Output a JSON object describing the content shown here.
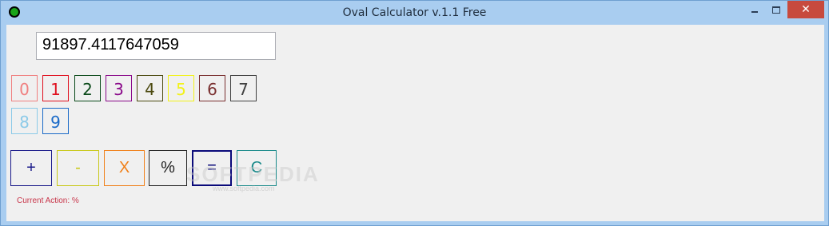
{
  "window": {
    "title": "Oval Calculator v.1.1  Free",
    "controls": {
      "minimize": "",
      "maximize": "",
      "close": "✕"
    }
  },
  "display": {
    "value": "91897.4117647059"
  },
  "digits": [
    {
      "label": "0",
      "color": "#f08080"
    },
    {
      "label": "1",
      "color": "#e0101f"
    },
    {
      "label": "2",
      "color": "#0b4a1a"
    },
    {
      "label": "3",
      "color": "#8a0a8a"
    },
    {
      "label": "4",
      "color": "#4c4a10"
    },
    {
      "label": "5",
      "color": "#f2f21a"
    },
    {
      "label": "6",
      "color": "#7a3030"
    },
    {
      "label": "7",
      "color": "#404040"
    },
    {
      "label": "8",
      "color": "#8ccae8"
    },
    {
      "label": "9",
      "color": "#1a6ac8"
    }
  ],
  "operators": [
    {
      "label": "+",
      "color": "#1a1a8a"
    },
    {
      "label": "-",
      "color": "#c8c81a"
    },
    {
      "label": "X",
      "color": "#f0801a"
    },
    {
      "label": "%",
      "color": "#222222"
    },
    {
      "label": "=",
      "color": "#0a0a7a"
    },
    {
      "label": "C",
      "color": "#1a8a8a"
    }
  ],
  "status": {
    "text": "Current Action: %"
  },
  "watermark": {
    "text": "SOFTPEDIA",
    "sub": "www.softpedia.com"
  }
}
